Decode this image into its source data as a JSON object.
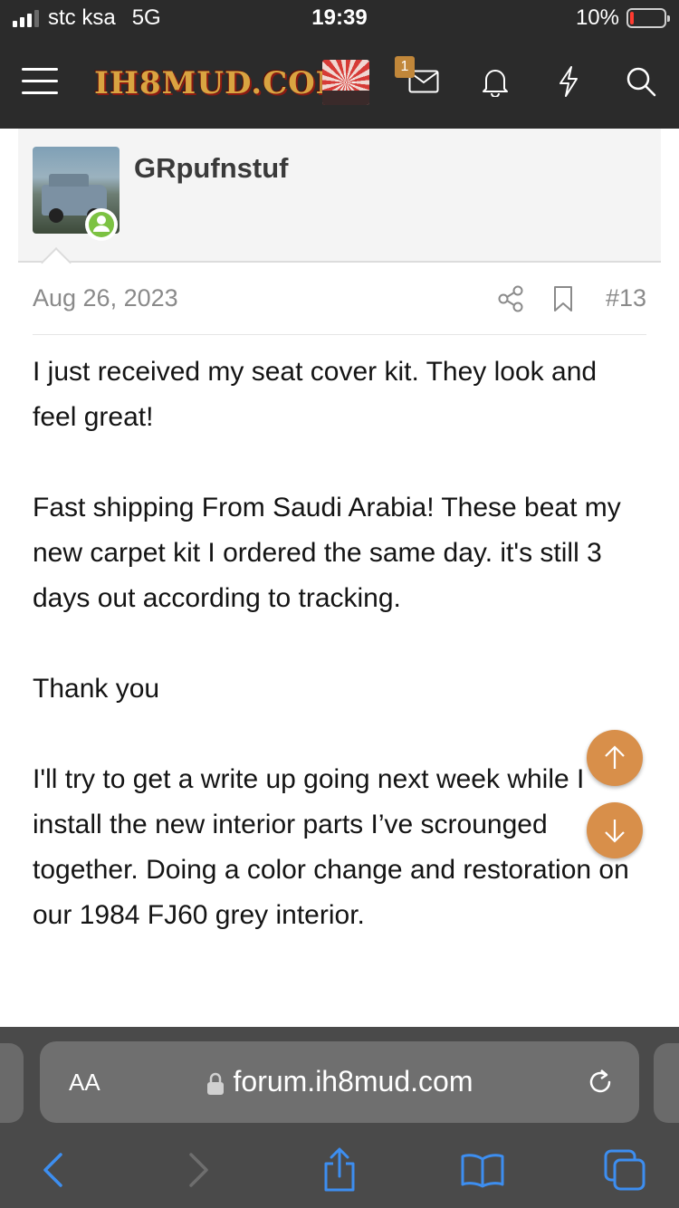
{
  "status_bar": {
    "carrier": "stc ksa",
    "network": "5G",
    "time": "19:39",
    "battery": "10%",
    "battery_level": 0.1
  },
  "header": {
    "logo_text": "IH8MUD.COM",
    "notification_count": "1",
    "icons": [
      "hamburger-menu-icon",
      "mail-icon",
      "bell-icon",
      "lightning-icon",
      "search-icon"
    ]
  },
  "post": {
    "username": "GRpufnstuf",
    "date": "Aug 26, 2023",
    "post_number": "#13",
    "paragraphs": [
      "I just received my seat cover kit. They look and feel great!",
      "Fast shipping From Saudi Arabia! These beat my new carpet kit I ordered the same day. it's still 3 days out according to tracking.",
      "Thank you",
      "I'll try to get a write up going next week while I install the new interior parts I’ve scrounged together. Doing a color change and restoration on our 1984 FJ60 grey interior."
    ]
  },
  "browser": {
    "text_size_label": "AA",
    "url": "forum.ih8mud.com",
    "accent_color": "#3d8ef0"
  },
  "colors": {
    "header_bg": "#2b2b2b",
    "brand_orange": "#d88f4a",
    "online_green": "#7cc242"
  }
}
